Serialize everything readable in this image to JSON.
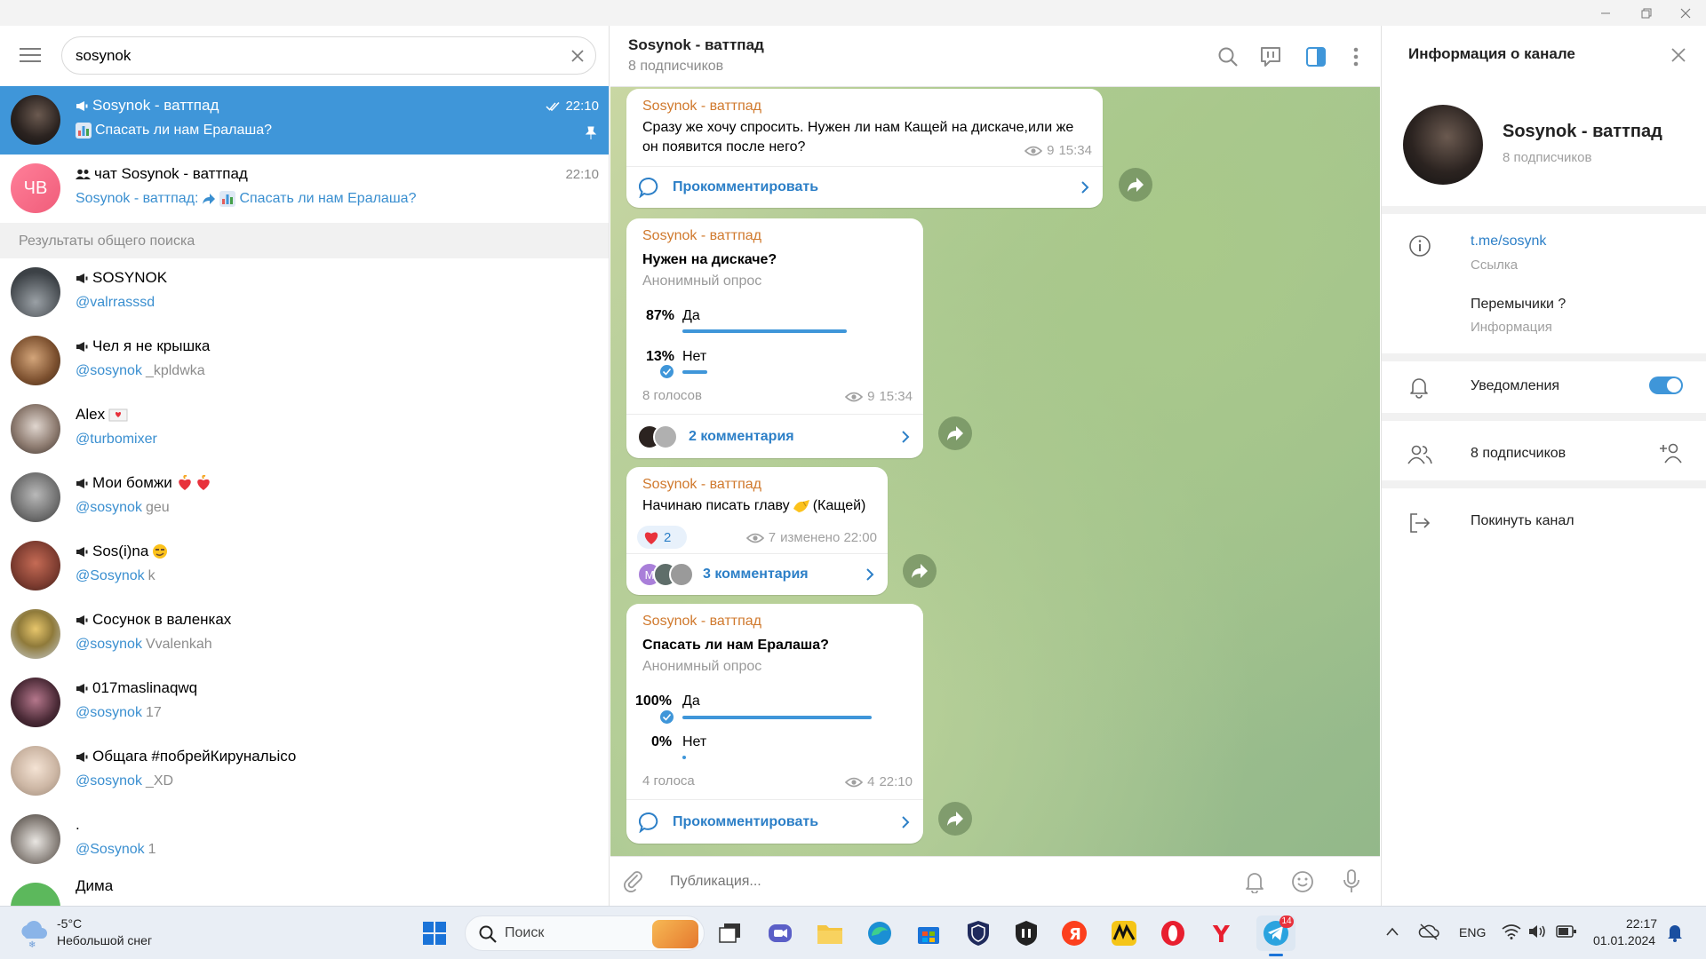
{
  "colors": {
    "accent": "#3f96d9",
    "author": "#d0792d",
    "link": "#2c7fc7",
    "selected_row": "#3f96d9",
    "heart": "#e8323c"
  },
  "sidebar": {
    "search_value": "sosynok",
    "chats": [
      {
        "name": "Sosynok - ваттпад",
        "preview": "Спасать ли нам Ералаша?",
        "time": "22:10",
        "type": "channel",
        "pinned": true,
        "read": true
      },
      {
        "name": "чат Sosynok - ваттпад",
        "avatar_initials": "ЧВ",
        "preview_prefix": "Sosynok - ваттпад:",
        "preview": "Спасать ли нам Ералаша?",
        "time": "22:10",
        "type": "group"
      }
    ],
    "global_results_header": "Результаты общего поиска",
    "results": [
      {
        "name": "SOSYNOK",
        "handle_match": "@valrrasssd",
        "handle_rest": "",
        "type": "channel"
      },
      {
        "name": "Чел я не крышка",
        "handle_match": "@sosynok",
        "handle_rest": "_kpldwka",
        "type": "channel"
      },
      {
        "name": "Alex",
        "handle_match": "@turbomixer",
        "handle_rest": "",
        "type": "user"
      },
      {
        "name": "Мои бомжи",
        "handle_match": "@sosynok",
        "handle_rest": "geu",
        "type": "channel"
      },
      {
        "name": "Sos(i)na",
        "handle_match": "@Sosynok",
        "handle_rest": "k",
        "type": "channel"
      },
      {
        "name": "Сосунок в валенках",
        "handle_match": "@sosynok",
        "handle_rest": "Vvalenkah",
        "type": "channel"
      },
      {
        "name": "017maslinaqwq",
        "handle_match": "@sosynok",
        "handle_rest": "17",
        "type": "channel"
      },
      {
        "name": "Общага #побрейКирунальісо",
        "handle_match": "@sosynok",
        "handle_rest": "_XD",
        "type": "channel"
      },
      {
        "name": ".",
        "handle_match": "@Sosynok",
        "handle_rest": "1",
        "type": "user"
      },
      {
        "name": "Дима",
        "handle_match": "",
        "handle_rest": "",
        "type": "user"
      }
    ]
  },
  "chat": {
    "title": "Sosynok - ваттпад",
    "subtitle": "8 подписчиков",
    "compose_placeholder": "Публикация...",
    "messages": [
      {
        "author": "Sosynok - ваттпад",
        "text": "Сразу же хочу спросить. Нужен ли нам Кащей на дискаче,или же он появится после него?",
        "views": "9",
        "time": "15:34",
        "comment_label": "Прокомментировать"
      },
      {
        "author": "Sosynok - ваттпад",
        "question": "Нужен на дискаче?",
        "poll_type": "Анонимный опрос",
        "options": [
          {
            "percent": "87%",
            "label": "Да",
            "fraction": 0.87,
            "chosen": false
          },
          {
            "percent": "13%",
            "label": "Нет",
            "fraction": 0.13,
            "chosen": true
          }
        ],
        "votes": "8 голосов",
        "views": "9",
        "time": "15:34",
        "comment_label": "2 комментария"
      },
      {
        "author": "Sosynok - ваттпад",
        "text": "Начинаю писать главу",
        "text_suffix": "(Кащей)",
        "reaction_count": "2",
        "views": "7",
        "time": "изменено 22:00",
        "comment_label": "3 комментария",
        "commenter_initial": "М"
      },
      {
        "author": "Sosynok - ваттпад",
        "question": "Спасать ли нам Ералаша?",
        "poll_type": "Анонимный опрос",
        "options": [
          {
            "percent": "100%",
            "label": "Да",
            "fraction": 1.0,
            "chosen": true
          },
          {
            "percent": "0%",
            "label": "Нет",
            "fraction": 0.0,
            "chosen": false
          }
        ],
        "votes": "4 голоса",
        "views": "4",
        "time": "22:10",
        "comment_label": "Прокомментировать"
      }
    ]
  },
  "info_panel": {
    "title": "Информация о канале",
    "name": "Sosynok - ваттпад",
    "subscribers": "8 подписчиков",
    "link": "t.me/sosynk",
    "link_label": "Ссылка",
    "description": "Перемычики ?",
    "description_label": "Информация",
    "notifications_label": "Уведомления",
    "notifications_on": true,
    "members_label": "8 подписчиков",
    "leave_label": "Покинуть канал"
  },
  "taskbar": {
    "weather_temp": "-5°C",
    "weather_desc": "Небольшой снег",
    "search_label": "Поиск",
    "language": "ENG",
    "time": "22:17",
    "date": "01.01.2024",
    "telegram_badge": "14"
  }
}
